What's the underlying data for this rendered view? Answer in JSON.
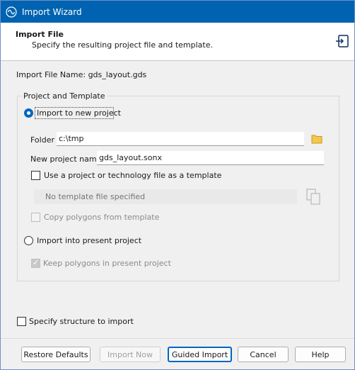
{
  "window": {
    "title": "Import Wizard",
    "accent_color": "#0063b1",
    "app_icon": "wave-icon"
  },
  "header": {
    "title": "Import File",
    "subtitle": "Specify the resulting project file and template.",
    "exit_icon": "exit-icon"
  },
  "import_file_name": {
    "label": "Import File Name:",
    "value": "gds_layout.gds"
  },
  "group": {
    "title": "Project and Template",
    "new_project": {
      "label": "Import to new project",
      "selected": true,
      "folder_label": "Folder",
      "folder_value": "c:\\tmp",
      "name_label": "New project name",
      "name_value": "gds_layout.sonx",
      "use_template_label": "Use a project or technology file as a template",
      "use_template_checked": false,
      "template_placeholder": "No template file specified",
      "copy_polygons_label": "Copy polygons from template",
      "copy_polygons_checked": false
    },
    "present_project": {
      "label": "Import into present project",
      "selected": false,
      "keep_polygons_label": "Keep polygons in present project",
      "keep_polygons_checked": true
    }
  },
  "specify_structure": {
    "label": "Specify structure to import",
    "checked": false
  },
  "buttons": {
    "restore": "Restore Defaults",
    "import_now": "Import Now",
    "guided": "Guided Import",
    "cancel": "Cancel",
    "help": "Help"
  }
}
